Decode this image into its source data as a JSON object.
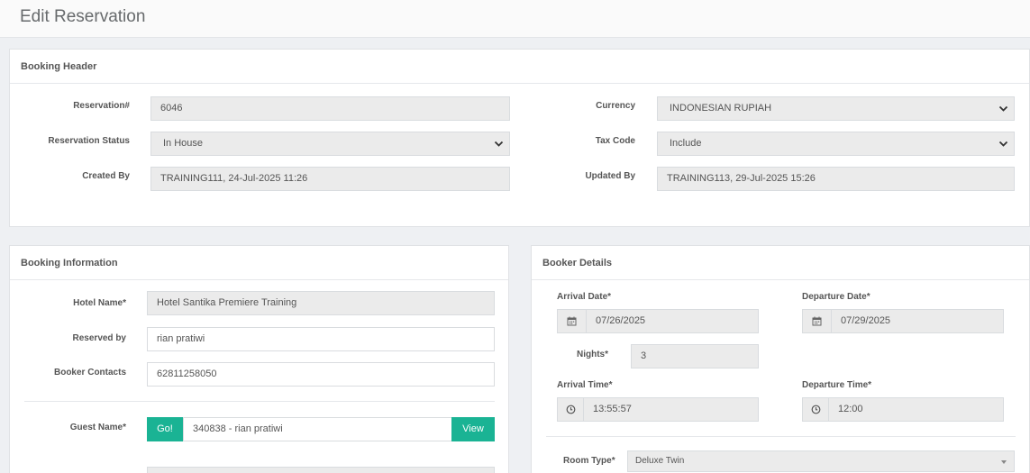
{
  "page": {
    "title": "Edit Reservation"
  },
  "booking_header": {
    "heading": "Booking Header",
    "reservation_label": "Reservation#",
    "reservation_value": "6046",
    "status_label": "Reservation Status",
    "status_value": "In House",
    "created_label": "Created By",
    "created_value": "TRAINING111, 24-Jul-2025 11:26",
    "currency_label": "Currency",
    "currency_value": "INDONESIAN RUPIAH",
    "tax_label": "Tax Code",
    "tax_value": "Include",
    "updated_label": "Updated By",
    "updated_value": "TRAINING113, 29-Jul-2025 15:26"
  },
  "booking_info": {
    "heading": "Booking Information",
    "hotel_label": "Hotel Name*",
    "hotel_value": "Hotel Santika Premiere Training",
    "reserved_label": "Reserved by",
    "reserved_value": "rian pratiwi",
    "contacts_label": "Booker Contacts",
    "contacts_value": "62811258050",
    "guest_label": "Guest Name*",
    "go_label": "Go!",
    "guest_value": "340838 - rian pratiwi",
    "view_label": "View"
  },
  "booker_details": {
    "heading": "Booker Details",
    "arrival_date_label": "Arrival Date*",
    "arrival_date_value": "07/26/2025",
    "departure_date_label": "Departure Date*",
    "departure_date_value": "07/29/2025",
    "nights_label": "Nights*",
    "nights_value": "3",
    "arrival_time_label": "Arrival Time*",
    "arrival_time_value": "13:55:57",
    "departure_time_label": "Departure Time*",
    "departure_time_value": "12:00",
    "room_type_label": "Room Type*",
    "room_type_value": "Deluxe Twin"
  },
  "icons": {
    "calendar": "calendar-icon",
    "clock": "clock-icon",
    "chevron": "chevron-down-icon"
  },
  "colors": {
    "accent": "#1ab394",
    "readonly_bg": "#ebebeb"
  }
}
